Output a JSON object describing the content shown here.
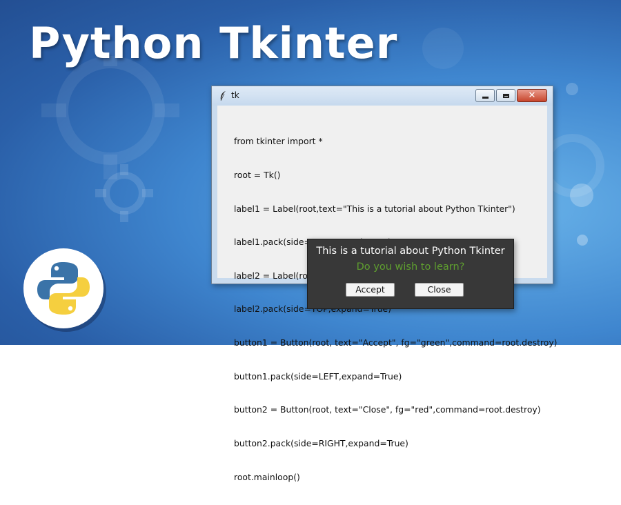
{
  "banner": {
    "headline": "Python Tkinter"
  },
  "window": {
    "title": "tk",
    "code_lines": [
      "from tkinter import *",
      "root = Tk()",
      "label1 = Label(root,text=\"This is a tutorial about Python Tkinter\")",
      "label1.pack(side=TOP,expand=True)",
      "label2 = Label(root,text=\"Do you wish to learn?\",fg=\"blue\")",
      "label2.pack(side=TOP,expand=True)",
      "button1 = Button(root, text=\"Accept\", fg=\"green\",command=root.destroy)",
      "button1.pack(side=LEFT,expand=True)",
      "button2 = Button(root, text=\"Close\", fg=\"red\",command=root.destroy)",
      "button2.pack(side=RIGHT,expand=True)",
      "root.mainloop()"
    ],
    "controls": {
      "minimize_icon": "minimize-icon",
      "maximize_icon": "maximize-icon",
      "close_icon": "close-icon"
    }
  },
  "output": {
    "label1": "This is a tutorial about Python Tkinter",
    "label2": "Do you wish to learn?",
    "label2_color": "#5f9f2f",
    "accept_label": "Accept",
    "close_label": "Close"
  },
  "colors": {
    "python_blue": "#3a73a8",
    "python_yellow": "#f5cf3f"
  }
}
